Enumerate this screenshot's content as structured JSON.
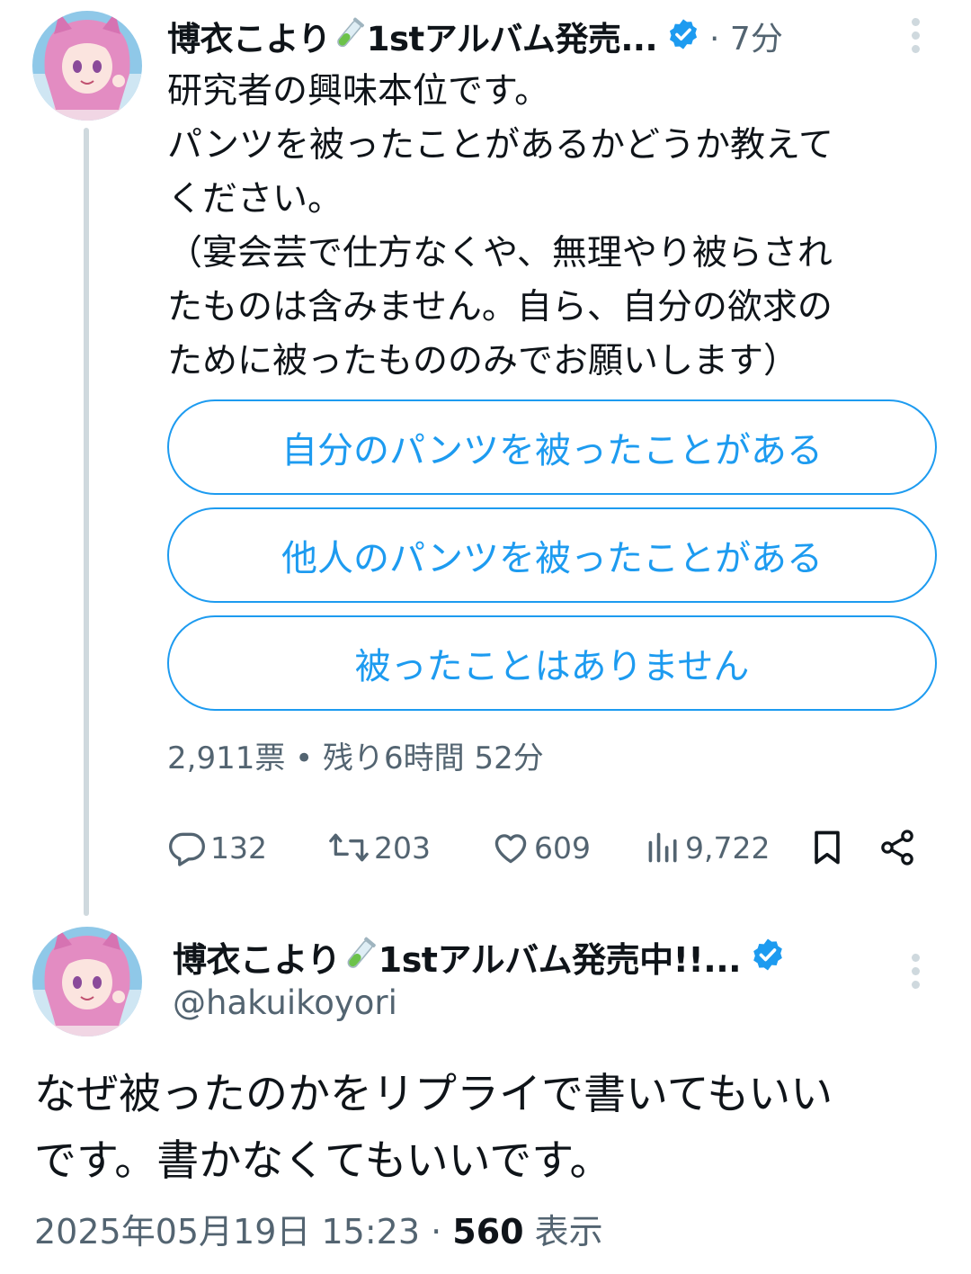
{
  "tweet1": {
    "display_name": "博衣こより",
    "display_name_suffix": "1stアルバム発売...",
    "time": "· 7分",
    "text_lines": [
      "研究者の興味本位です。",
      "パンツを被ったことがあるかどうか教えて",
      "ください。",
      "（宴会芸で仕方なくや、無理やり被らされ",
      "たものは含みません。自ら、自分の欲求の",
      "ために被ったもののみでお願いします）"
    ],
    "poll": {
      "options": [
        "自分のパンツを被ったことがある",
        "他人のパンツを被ったことがある",
        "被ったことはありません"
      ],
      "meta": "2,911票 • 残り6時間 52分"
    },
    "actions": {
      "replies": "132",
      "retweets": "203",
      "likes": "609",
      "views": "9,722"
    }
  },
  "tweet2": {
    "display_name": "博衣こより",
    "display_name_suffix": "1stアルバム発売中!!...",
    "handle": "@hakuikoyori",
    "text_lines": [
      "なぜ被ったのかをリプライで書いてもいい",
      "です。書かなくてもいいです。"
    ],
    "timestamp": "2025年05月19日 15:23 · ",
    "view_count": "560",
    "views_label": " 表示"
  },
  "colors": {
    "accent": "#1d9bf0",
    "secondary_text": "#536471",
    "primary_text": "#0f1419",
    "thread_line": "#cfd9de"
  },
  "icons": [
    "avatar",
    "test-tube-icon",
    "verified-badge-icon",
    "more-options-icon",
    "reply-icon",
    "retweet-icon",
    "like-icon",
    "views-icon",
    "bookmark-icon",
    "share-icon"
  ]
}
